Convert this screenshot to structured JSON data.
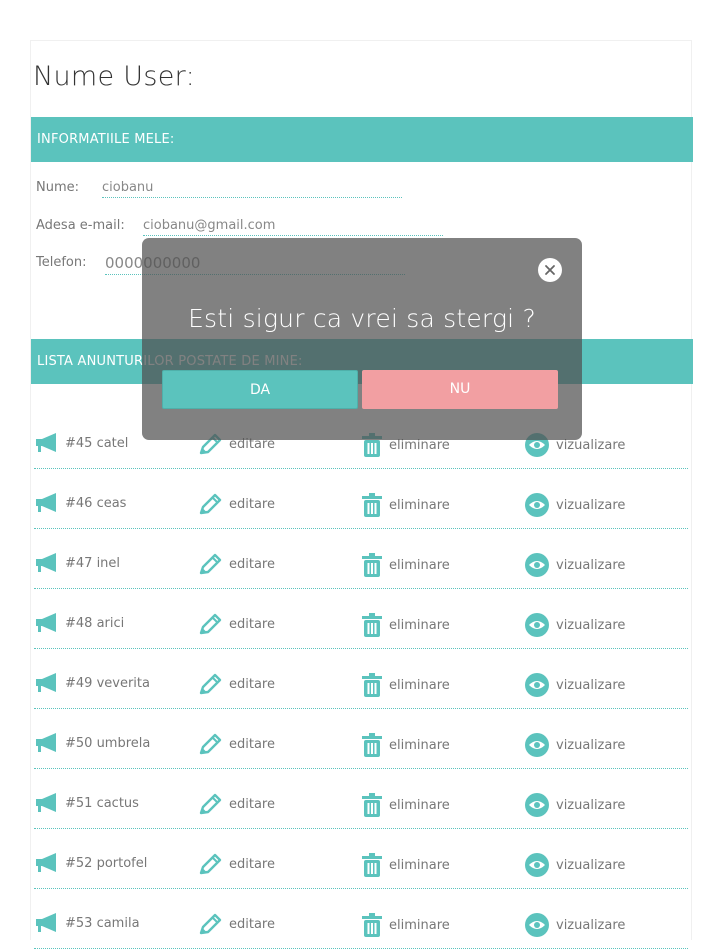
{
  "page": {
    "title": "Nume User:"
  },
  "info_section": {
    "header": "INFORMATIILE MELE:",
    "fields": [
      {
        "label": "Nume:",
        "value": "ciobanu"
      },
      {
        "label": "Adesa e-mail:",
        "value": "ciobanu@gmail.com"
      },
      {
        "label": "Telefon:",
        "value": "0000000000"
      }
    ]
  },
  "ads_section": {
    "header": "LISTA ANUNTURILOR POSTATE DE MINE:",
    "actions": {
      "edit": "editare",
      "delete": "eliminare",
      "view": "vizualizare"
    },
    "items": [
      {
        "label": "#45 catel"
      },
      {
        "label": "#46 ceas"
      },
      {
        "label": "#47 inel"
      },
      {
        "label": "#48 arici"
      },
      {
        "label": "#49 veverita"
      },
      {
        "label": "#50 umbrela"
      },
      {
        "label": "#51 cactus"
      },
      {
        "label": "#52 portofel"
      },
      {
        "label": "#53 camila"
      }
    ]
  },
  "confirm_dialog": {
    "message": "Esti sigur ca vrei sa stergi ?",
    "yes_label": "DA",
    "no_label": "NU"
  },
  "icons": {
    "item": "megaphone-icon",
    "edit": "pencil-icon",
    "delete": "trash-icon",
    "view": "eye-icon",
    "close": "close-icon"
  },
  "colors": {
    "accent": "#5bc3bd",
    "danger_button": "#f29fa2",
    "overlay": "#505050"
  }
}
